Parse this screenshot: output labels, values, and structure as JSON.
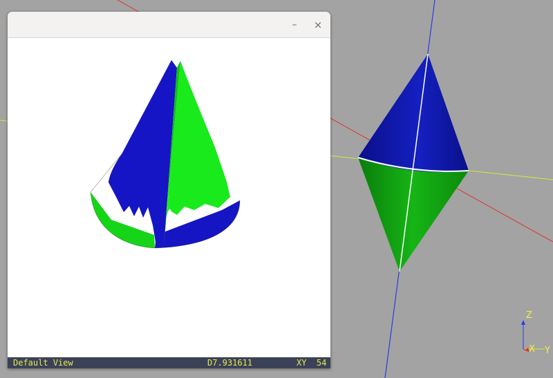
{
  "viewport": {
    "background_color": "#a3a3a3",
    "axis_colors": {
      "x": "#e0302a",
      "y": "#c8f03c",
      "z": "#2a3ae8"
    },
    "axes_triad": {
      "z_label": "Z",
      "x_label": "X",
      "y_label": "Y"
    },
    "object": {
      "name": "double-cone",
      "top_color": "#0f16a8",
      "bottom_color": "#12a812",
      "edge_color": "#ffffff"
    }
  },
  "window": {
    "minimize_icon": "minimize-icon",
    "close_icon": "close-icon",
    "minimize_glyph": "–",
    "close_glyph": "×",
    "view": {
      "background_color": "#ffffff",
      "object": {
        "name": "cone",
        "color_a": "#1414c8",
        "color_b": "#16e81a"
      }
    },
    "statusbar": {
      "view_name": "Default View",
      "distance": "D7.931611",
      "plane": "XY",
      "extra": "54"
    }
  }
}
